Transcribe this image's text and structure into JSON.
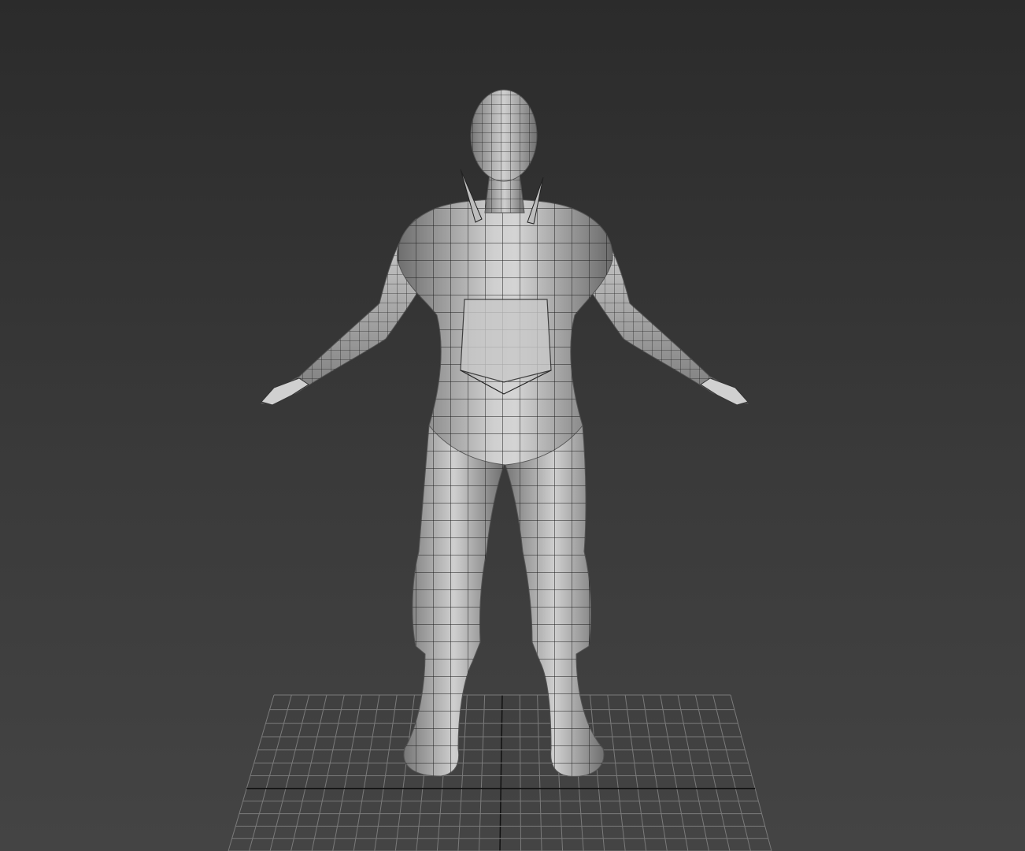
{
  "viewport": {
    "background_top": "#2b2b2b",
    "background_bottom": "#444444",
    "grid_line_color": "#7a7a7a",
    "grid_axis_color": "#111111"
  },
  "model": {
    "shade_color": "#9a9a9a",
    "highlight_color": "#dcdcdc",
    "wire_color": "#1a1a1a"
  }
}
